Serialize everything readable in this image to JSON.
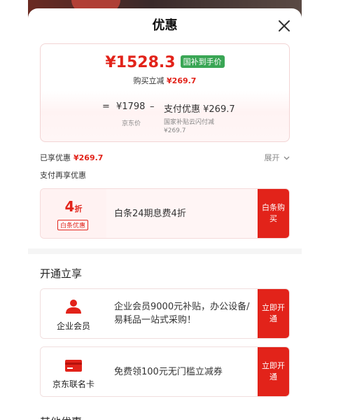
{
  "sheet": {
    "title": "优惠"
  },
  "summary": {
    "price": "¥1528.3",
    "price_tag": "国补到手价",
    "buy_label": "购买立减",
    "buy_amount": "¥269.7",
    "equals": "=",
    "minus": "–",
    "jd_price": "¥1798",
    "jd_price_label": "京东价",
    "pay_discount": "支付优惠 ¥269.7",
    "pay_discount_line1": "国家补贴云闪付减",
    "pay_discount_line2": "¥269.7"
  },
  "enjoyed": {
    "label": "已享优惠",
    "amount": "¥269.7",
    "expand_label": "展开"
  },
  "pay_section": {
    "title": "支付再享优惠",
    "card": {
      "num": "4",
      "unit": "折",
      "badge": "白条优惠",
      "desc": "白条24期息费4折",
      "action": "白条购买"
    }
  },
  "open_section": {
    "title": "开通立享",
    "items": [
      {
        "label": "企业会员",
        "desc": "企业会员9000元补贴，办公设备/易耗品一站式采购！",
        "action": "立即开通"
      },
      {
        "label": "京东联名卡",
        "desc": "免费领100元无门槛立减券",
        "action": "立即开通"
      }
    ]
  },
  "other_section": {
    "title": "其他优惠"
  },
  "colors": {
    "accent_red": "#e2231a",
    "tag_green": "#3aa655"
  }
}
